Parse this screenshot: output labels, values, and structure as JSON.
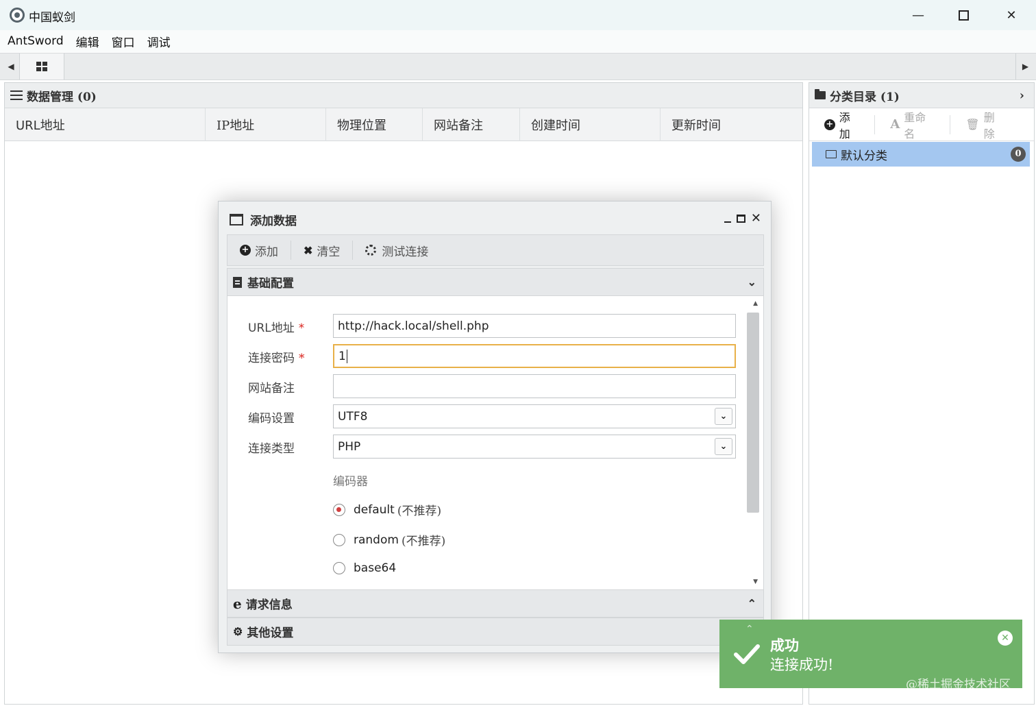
{
  "window": {
    "title": "中国蚁剑",
    "minimize": "—",
    "close": "✕"
  },
  "menu": [
    "AntSword",
    "编辑",
    "窗口",
    "调试"
  ],
  "data_panel": {
    "title": "数据管理 (0)",
    "columns": [
      "URL地址",
      "IP地址",
      "物理位置",
      "网站备注",
      "创建时间",
      "更新时间"
    ]
  },
  "category_panel": {
    "title": "分类目录 (1)",
    "toolbar": {
      "add": "添加",
      "rename": "重命名",
      "delete": "删除"
    },
    "items": [
      {
        "label": "默认分类",
        "count": "0"
      }
    ]
  },
  "dialog": {
    "title": "添加数据",
    "toolbar": {
      "add": "添加",
      "clear": "清空",
      "test": "测试连接"
    },
    "sections": {
      "basic": "基础配置",
      "request": "请求信息",
      "other": "其他设置"
    },
    "fields": {
      "url": {
        "label": "URL地址",
        "value": "http://hack.local/shell.php",
        "required": "*"
      },
      "password": {
        "label": "连接密码",
        "value": "1",
        "required": "*"
      },
      "note": {
        "label": "网站备注",
        "value": ""
      },
      "encoding": {
        "label": "编码设置",
        "value": "UTF8"
      },
      "type": {
        "label": "连接类型",
        "value": "PHP"
      }
    },
    "encoder": {
      "title": "编码器",
      "options": [
        {
          "name": "default",
          "hint": "(不推荐)",
          "checked": true
        },
        {
          "name": "random",
          "hint": "(不推荐)",
          "checked": false
        },
        {
          "name": "base64",
          "hint": "",
          "checked": false
        }
      ]
    }
  },
  "toast": {
    "title": "成功",
    "message": "连接成功!",
    "color": "#6fb269"
  },
  "watermark": "@稀土掘金技术社区"
}
